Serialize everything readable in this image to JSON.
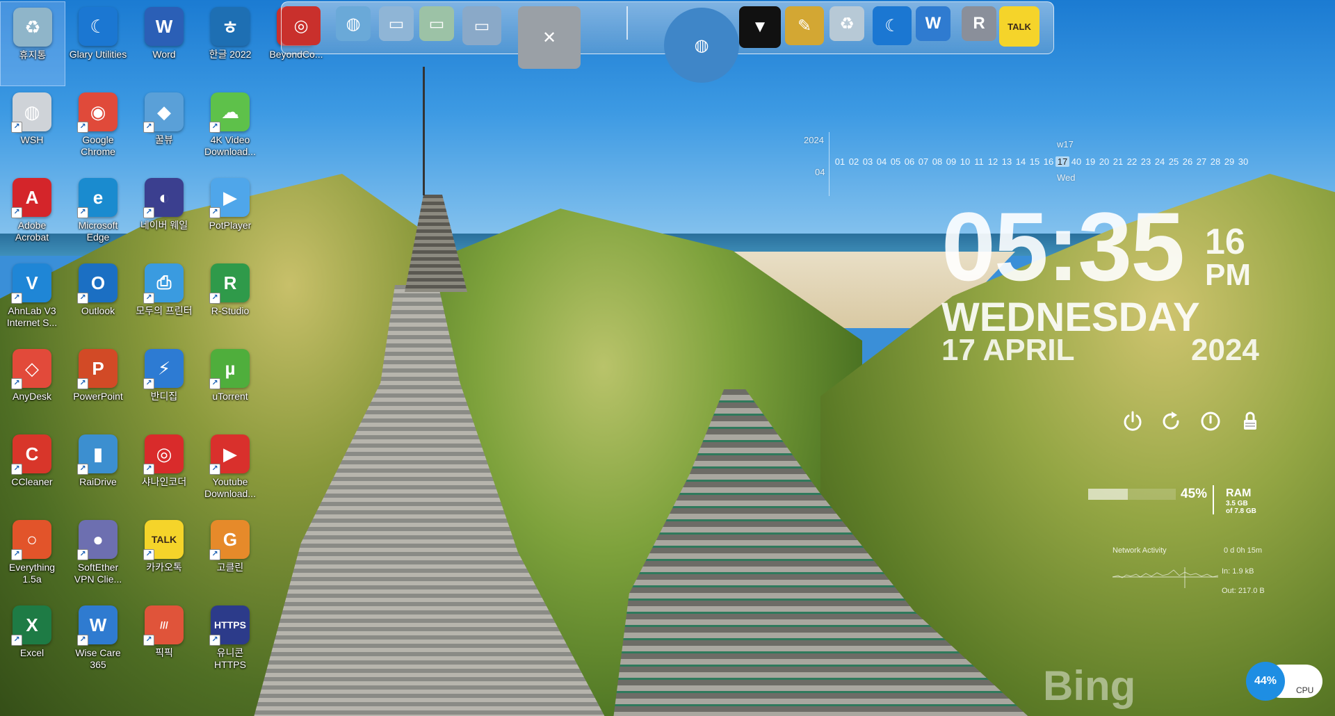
{
  "desktop_icons": [
    {
      "label": "휴지통",
      "color": "#8fb5c9",
      "glyph": "♻",
      "selected": true
    },
    {
      "label": "Glary Utilities",
      "color": "#1b77d2",
      "glyph": "☾"
    },
    {
      "label": "Word",
      "color": "#2b5fb6",
      "glyph": "W"
    },
    {
      "label": "한글 2022",
      "color": "#1e6fb3",
      "glyph": "ㅎ"
    },
    {
      "label": "BeyondCo...",
      "color": "#c9302c",
      "glyph": "◎"
    },
    {
      "label": "WSH",
      "color": "#cfd3d8",
      "glyph": "◍"
    },
    {
      "label": "Google Chrome",
      "color": "#e04a3a",
      "glyph": "◉"
    },
    {
      "label": "꿀뷰",
      "color": "#5aa0d8",
      "glyph": "◆"
    },
    {
      "label": "4K Video Download...",
      "color": "#5ec14a",
      "glyph": "☁"
    },
    {
      "label": "Adobe Acrobat",
      "color": "#d4252a",
      "glyph": "A"
    },
    {
      "label": "Microsoft Edge",
      "color": "#1a8bcf",
      "glyph": "e"
    },
    {
      "label": "네이버 웨일",
      "color": "#3b3f8f",
      "glyph": "◐"
    },
    {
      "label": "PotPlayer",
      "color": "#4fa6ea",
      "glyph": "▶"
    },
    {
      "label": "AhnLab V3 Internet S...",
      "color": "#1f86d6",
      "glyph": "V"
    },
    {
      "label": "Outlook",
      "color": "#1b6fc3",
      "glyph": "O"
    },
    {
      "label": "모두의 프린터",
      "color": "#3a9be0",
      "glyph": "⎙"
    },
    {
      "label": "R-Studio",
      "color": "#2f9a4a",
      "glyph": "R"
    },
    {
      "label": "AnyDesk",
      "color": "#e24a3a",
      "glyph": "◇"
    },
    {
      "label": "PowerPoint",
      "color": "#d24a26",
      "glyph": "P"
    },
    {
      "label": "반디집",
      "color": "#2d7bd3",
      "glyph": "⚡"
    },
    {
      "label": "uTorrent",
      "color": "#4fae3c",
      "glyph": "µ"
    },
    {
      "label": "CCleaner",
      "color": "#d8362a",
      "glyph": "C"
    },
    {
      "label": "RaiDrive",
      "color": "#3c8fd0",
      "glyph": "▮"
    },
    {
      "label": "샤나인코더",
      "color": "#d92b2b",
      "glyph": "◎"
    },
    {
      "label": "Youtube Download...",
      "color": "#d9302c",
      "glyph": "▶"
    },
    {
      "label": "Everything 1.5a",
      "color": "#e2542a",
      "glyph": "○"
    },
    {
      "label": "SoftEther VPN Clie...",
      "color": "#6d6fb0",
      "glyph": "●"
    },
    {
      "label": "카카오톡",
      "color": "#f5d42a",
      "glyph": "TALK"
    },
    {
      "label": "고클린",
      "color": "#e68a2a",
      "glyph": "G"
    },
    {
      "label": "Excel",
      "color": "#1e7b45",
      "glyph": "X"
    },
    {
      "label": "Wise Care 365",
      "color": "#2f7bd0",
      "glyph": "W"
    },
    {
      "label": "픽픽",
      "color": "#e0543a",
      "glyph": "///"
    },
    {
      "label": "유니콘 HTTPS",
      "color": "#2c3b8a",
      "glyph": "HTTPS"
    }
  ],
  "dock": {
    "items": [
      {
        "name": "dock-disk-burner",
        "glyph": "◎",
        "color": "#c9302c"
      },
      {
        "name": "dock-network-browser",
        "glyph": "◍",
        "color": "#6aa9d8"
      },
      {
        "name": "dock-folder-1",
        "glyph": "▭",
        "color": "#8fb5d6"
      },
      {
        "name": "dock-folder-2",
        "glyph": "▭",
        "color": "#9cc2a6"
      },
      {
        "name": "dock-folder-3",
        "glyph": "▭",
        "color": "#8aa9c8"
      },
      {
        "name": "dock-utilities",
        "glyph": "✕",
        "color": "#9aa0a6"
      },
      {
        "name": "dock-globe",
        "glyph": "◍",
        "color": "#3f86c8"
      },
      {
        "name": "dock-tshirt",
        "glyph": "▼",
        "color": "#111111"
      },
      {
        "name": "dock-tools",
        "glyph": "✎",
        "color": "#d3a733"
      },
      {
        "name": "dock-recycle",
        "glyph": "♻",
        "color": "#b7c9d6"
      },
      {
        "name": "dock-glary",
        "glyph": "☾",
        "color": "#1b77d2"
      },
      {
        "name": "dock-wise",
        "glyph": "W",
        "color": "#2f7bd0"
      },
      {
        "name": "dock-rbox",
        "glyph": "R",
        "color": "#8a8f9a"
      },
      {
        "name": "dock-kakaotalk",
        "glyph": "TALK",
        "color": "#f5d42a"
      }
    ]
  },
  "calendar": {
    "year": "2024",
    "month": "04",
    "week": "w17",
    "dayname": "Wed",
    "days": [
      "01",
      "02",
      "03",
      "04",
      "05",
      "06",
      "07",
      "08",
      "09",
      "10",
      "11",
      "12",
      "13",
      "14",
      "15",
      "16",
      "17",
      "40",
      "19",
      "20",
      "21",
      "22",
      "23",
      "24",
      "25",
      "26",
      "27",
      "28",
      "29",
      "30"
    ],
    "today": "17"
  },
  "clock": {
    "time": "05:35",
    "seconds": "16",
    "ampm": "PM",
    "weekday": "WEDNESDAY",
    "date": "17 APRIL",
    "year": "2024"
  },
  "power_buttons": [
    {
      "name": "shutdown-icon",
      "glyph": "⏻"
    },
    {
      "name": "restart-icon",
      "glyph": "↻"
    },
    {
      "name": "logoff-icon",
      "glyph": "⏼"
    },
    {
      "name": "lock-icon",
      "glyph": "🔒"
    }
  ],
  "ram": {
    "percent": "45%",
    "fraction": 0.45,
    "label": "RAM",
    "used": "3.5 GB",
    "total": "of 7.8 GB"
  },
  "network": {
    "title": "Network Activity",
    "uptime": "0 d 0h 15m",
    "in": "In: 1.9 kB",
    "out": "Out: 217.0 B"
  },
  "bing": "Bing",
  "cpu": {
    "percent": "44%",
    "label": "CPU"
  }
}
